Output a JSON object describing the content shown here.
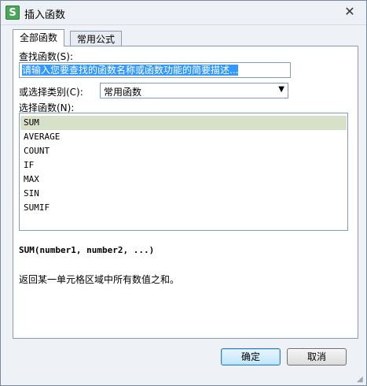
{
  "window": {
    "title": "插入函数",
    "app_icon_letter": "S",
    "close_glyph": "✕"
  },
  "tabs": [
    {
      "label": "全部函数",
      "active": true
    },
    {
      "label": "常用公式",
      "active": false
    }
  ],
  "search": {
    "label": "查找函数(S):",
    "value": "请输入您要查找的函数名称或函数功能的简要描述..."
  },
  "category": {
    "label": "或选择类别(C):",
    "selected": "常用函数"
  },
  "function_list": {
    "label": "选择函数(N):",
    "items": [
      "SUM",
      "AVERAGE",
      "COUNT",
      "IF",
      "MAX",
      "SIN",
      "SUMIF"
    ],
    "selected_index": 0
  },
  "syntax": "SUM(number1, number2, ...)",
  "description": "返回某一单元格区域中所有数值之和。",
  "buttons": {
    "ok": "确定",
    "cancel": "取消"
  },
  "colors": {
    "selection_highlight": "#d7e0c8",
    "search_highlight": "#3399ff",
    "app_icon": "#4aa65a"
  }
}
